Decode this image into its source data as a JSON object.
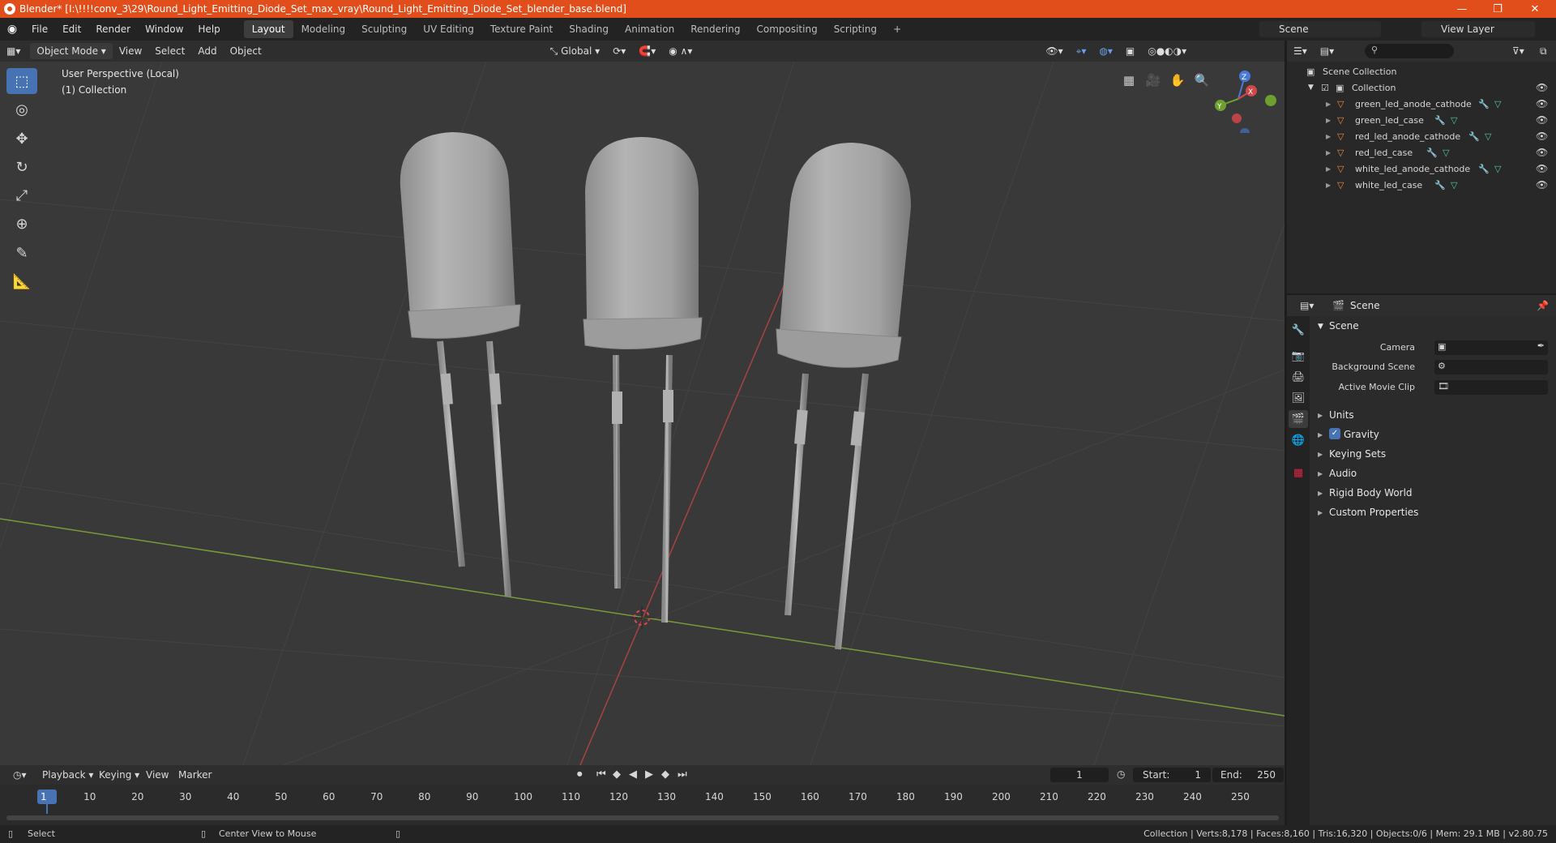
{
  "titlebar": {
    "title": "Blender* [I:\\!!!!conv_3\\29\\Round_Light_Emitting_Diode_Set_max_vray\\Round_Light_Emitting_Diode_Set_blender_base.blend]",
    "minimize": "—",
    "maximize": "❐",
    "close": "✕"
  },
  "menus": [
    "File",
    "Edit",
    "Render",
    "Window",
    "Help"
  ],
  "workspaces": [
    "Layout",
    "Modeling",
    "Sculpting",
    "UV Editing",
    "Texture Paint",
    "Shading",
    "Animation",
    "Rendering",
    "Compositing",
    "Scripting"
  ],
  "add_workspace": "+",
  "scene_name": "Scene",
  "view_layer": "View Layer",
  "viewport_header": {
    "mode": "Object Mode",
    "view": "View",
    "select": "Select",
    "add": "Add",
    "object": "Object",
    "transform": "Global"
  },
  "viewport": {
    "perspective": "User Perspective (Local)",
    "collection": "(1) Collection",
    "gizmo": {
      "z": "Z",
      "y": "Y",
      "x": "X"
    }
  },
  "outliner": {
    "root": "Scene Collection",
    "collection": "Collection",
    "objects": [
      "green_led_anode_cathode",
      "green_led_case",
      "red_led_anode_cathode",
      "red_led_case",
      "white_led_anode_cathode",
      "white_led_case"
    ]
  },
  "properties": {
    "context": "Scene",
    "panel": "Scene",
    "camera_label": "Camera",
    "background_label": "Background Scene",
    "clip_label": "Active Movie Clip",
    "sections": [
      "Units",
      "Gravity",
      "Keying Sets",
      "Audio",
      "Rigid Body World",
      "Custom Properties"
    ],
    "gravity_checked": true
  },
  "timeline": {
    "playback": "Playback",
    "keying": "Keying",
    "view": "View",
    "marker": "Marker",
    "current_frame": "1",
    "start_label": "Start:",
    "start": "1",
    "end_label": "End:",
    "end": "250",
    "ticks": [
      "1",
      "10",
      "20",
      "30",
      "40",
      "50",
      "60",
      "70",
      "80",
      "90",
      "100",
      "110",
      "120",
      "130",
      "140",
      "150",
      "160",
      "170",
      "180",
      "190",
      "200",
      "210",
      "220",
      "230",
      "240",
      "250"
    ]
  },
  "status": {
    "left": "Select",
    "middle": "Center View to Mouse",
    "right": "Collection | Verts:8,178 | Faces:8,160 | Tris:16,320 | Objects:0/6 | Mem: 29.1 MB | v2.80.75"
  }
}
